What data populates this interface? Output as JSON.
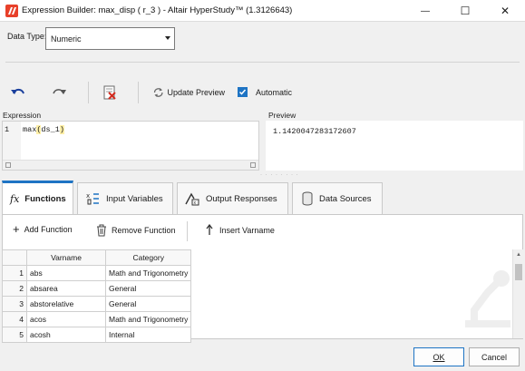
{
  "window": {
    "title": "Expression Builder: max_disp ( r_3 ) - Altair HyperStudy™ (1.3126643)",
    "controls": {
      "minimize": "—",
      "maximize": "☐",
      "close": "✕"
    }
  },
  "data_type": {
    "label": "Data Type:",
    "value": "Numeric"
  },
  "toolbar": {
    "update_preview": "Update Preview",
    "automatic": "Automatic",
    "automatic_checked": true
  },
  "expression": {
    "label": "Expression",
    "line_number": "1",
    "text_prefix": "max",
    "text_paren_open": "(",
    "text_arg": "ds_1",
    "text_paren_close": ")"
  },
  "preview": {
    "label": "Preview",
    "value": "1.1420047283172607"
  },
  "tabs": [
    {
      "label": "Functions",
      "icon": "fx-icon",
      "active": true
    },
    {
      "label": "Input Variables",
      "icon": "input-variables-icon",
      "active": false
    },
    {
      "label": "Output Responses",
      "icon": "output-responses-icon",
      "active": false
    },
    {
      "label": "Data Sources",
      "icon": "database-icon",
      "active": false
    }
  ],
  "functions_toolbar": {
    "add": "Add Function",
    "remove": "Remove Function",
    "insert": "Insert Varname"
  },
  "table": {
    "headers": [
      "Varname",
      "Category"
    ],
    "rows": [
      {
        "num": "1",
        "varname": "abs",
        "category": "Math and Trigonometry"
      },
      {
        "num": "2",
        "varname": "absarea",
        "category": "General"
      },
      {
        "num": "3",
        "varname": "abstorelative",
        "category": "General"
      },
      {
        "num": "4",
        "varname": "acos",
        "category": "Math and Trigonometry"
      },
      {
        "num": "5",
        "varname": "acosh",
        "category": "Internal"
      }
    ]
  },
  "footer": {
    "ok": "OK",
    "cancel": "Cancel"
  },
  "colors": {
    "accent": "#1e74c4",
    "highlight": "#fff0a8",
    "window_bg": "#f0f0f0"
  }
}
